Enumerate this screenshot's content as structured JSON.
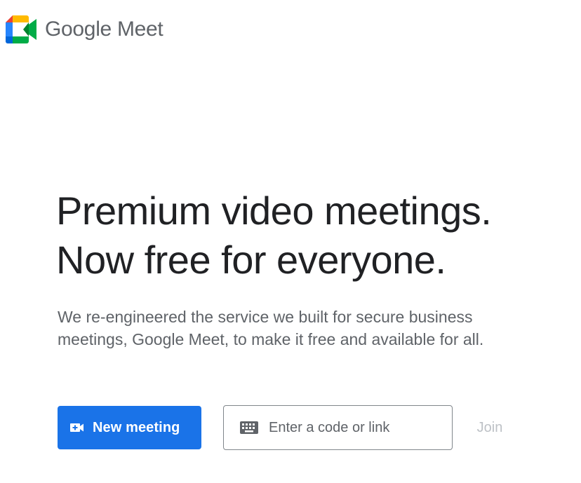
{
  "header": {
    "logo_text": "Google Meet",
    "logo_colors": {
      "green": "#00ac47",
      "blue": "#0066da",
      "red": "#ea4335",
      "yellow": "#ffba00",
      "dark_green": "#00832d",
      "light_blue": "#2684fc"
    }
  },
  "hero": {
    "headline_line1": "Premium video meetings.",
    "headline_line2": "Now free for everyone.",
    "subtext_line1": "We re-engineered the service we built for secure business",
    "subtext_line2": "meetings, Google Meet, to make it free and available for all."
  },
  "actions": {
    "new_meeting_label": "New meeting",
    "new_meeting_icon": "video-add-icon",
    "code_placeholder": "Enter a code or link",
    "code_value": "",
    "code_icon": "keyboard-icon",
    "join_label": "Join",
    "accent_color": "#1a73e8"
  }
}
